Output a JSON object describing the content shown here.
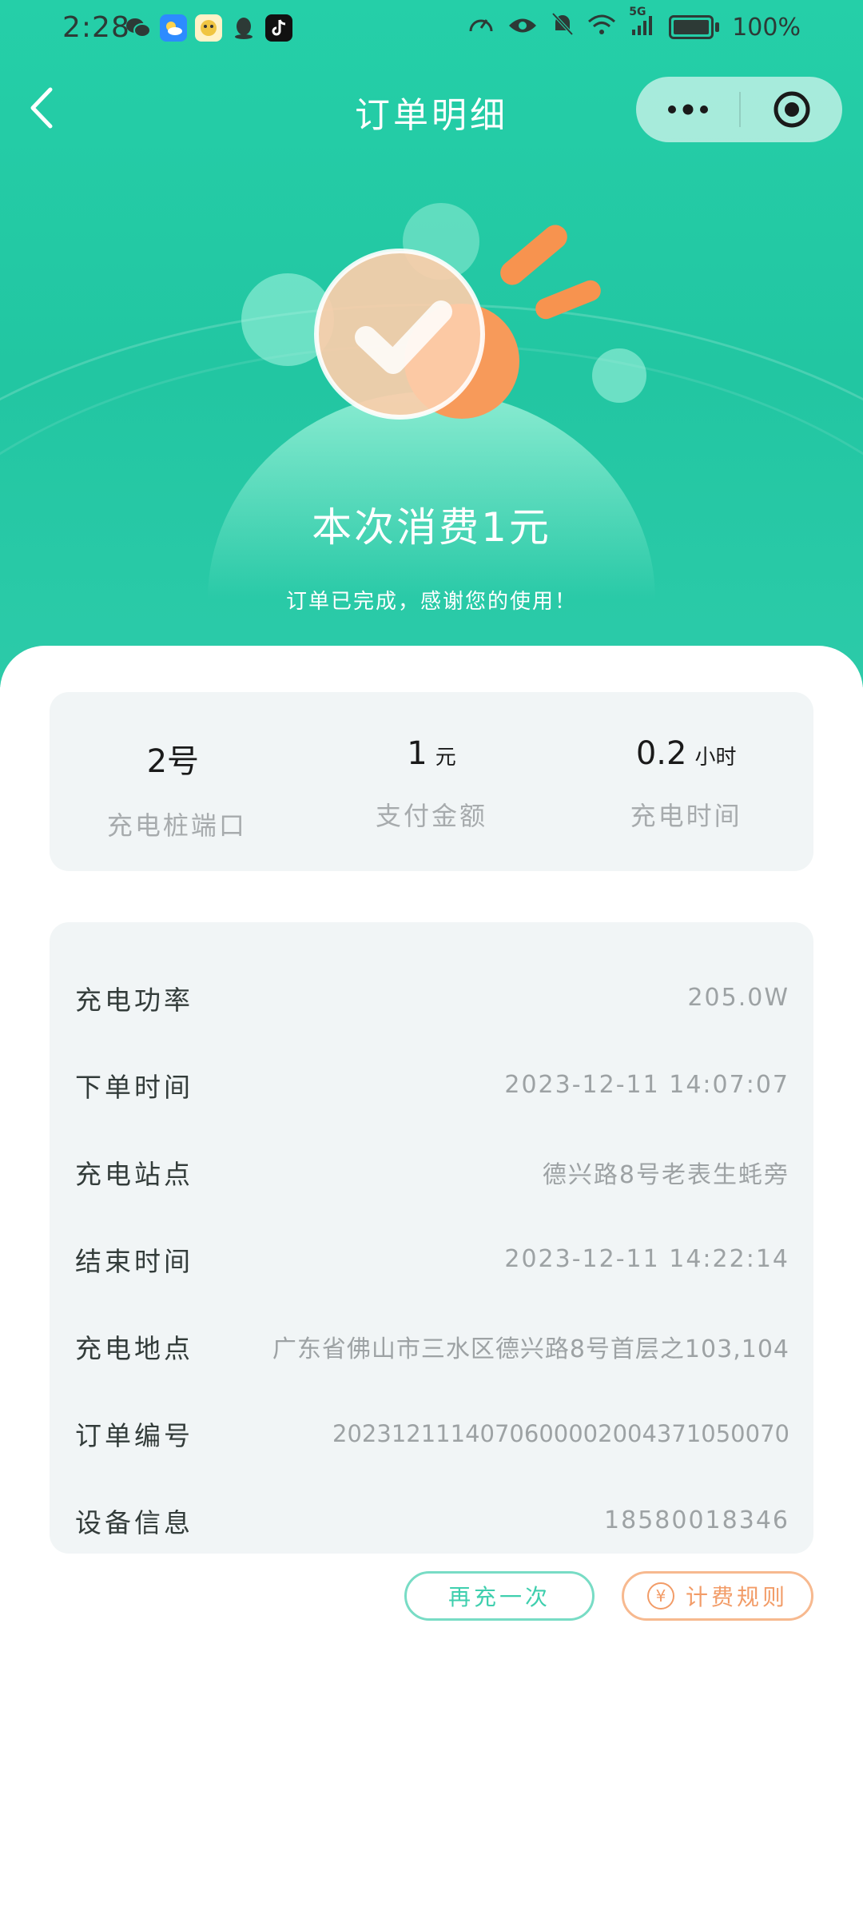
{
  "status_bar": {
    "time": "2:28",
    "left_icons": [
      "wechat-icon",
      "weather-icon",
      "app-icon",
      "qq-icon",
      "tiktok-icon"
    ],
    "right_icons": [
      "speed-icon",
      "eye-icon",
      "mute-icon",
      "wifi-icon",
      "signal-5g-icon",
      "battery-icon"
    ],
    "signal_label": "5G",
    "battery": "100%"
  },
  "nav": {
    "title": "订单明细",
    "back_icon": "back-chevron-icon",
    "more_icon": "more-dots-icon",
    "close_icon": "close-target-icon"
  },
  "hero": {
    "amount_text": "本次消费1元",
    "message": "订单已完成，感谢您的使用！"
  },
  "summary": [
    {
      "value": "2号",
      "unit": "",
      "label": "充电桩端口"
    },
    {
      "value": "1",
      "unit": "元",
      "label": "支付金额"
    },
    {
      "value": "0.2",
      "unit": "小时",
      "label": "充电时间"
    }
  ],
  "details": [
    {
      "label": "充电功率",
      "value": "205.0W"
    },
    {
      "label": "下单时间",
      "value": "2023-12-11 14:07:07"
    },
    {
      "label": "充电站点",
      "value": "德兴路8号老表生蚝旁"
    },
    {
      "label": "结束时间",
      "value": "2023-12-11 14:22:14"
    },
    {
      "label": "充电地点",
      "value": "广东省佛山市三水区德兴路8号首层之103,104"
    },
    {
      "label": "订单编号",
      "value": "2023121114070600002004371050070"
    },
    {
      "label": "设备信息",
      "value": "18580018346"
    }
  ],
  "buttons": {
    "recharge": "再充一次",
    "billing_rules": "计费规则",
    "billing_icon": "yen-icon",
    "yen_symbol": "¥"
  },
  "colors": {
    "primary": "#25cfa8",
    "accent_orange": "#f29c68",
    "card_bg": "#f1f5f6"
  }
}
